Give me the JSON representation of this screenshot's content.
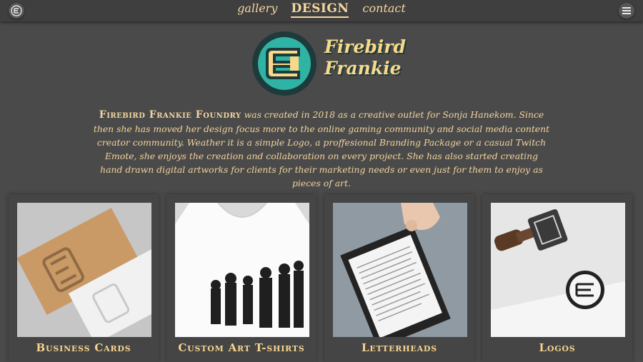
{
  "nav": {
    "items": [
      {
        "label": "gallery"
      },
      {
        "label": "DESIGN"
      },
      {
        "label": "contact"
      }
    ]
  },
  "brand": {
    "line1": "Firebird",
    "line2": "Frankie"
  },
  "description": {
    "lead": "Firebird Frankie Foundry",
    "body": " was created in 2018 as a creative outlet for Sonja Hanekom. Since then she has moved her design focus more to the online gaming community and social media content creator community. Weather it is a simple Logo, a proffesional Branding Package or a casual Twitch Emote, she enjoys the creation and collaboration on every project. She has also started creating hand drawn digital artworks for clients for their marketing needs or even just for them to enjoy as  pieces of art."
  },
  "cards": [
    {
      "title": "Business Cards"
    },
    {
      "title": "Custom Art T-shirts"
    },
    {
      "title": "Letterheads"
    },
    {
      "title": "Logos"
    }
  ],
  "colors": {
    "background": "#4a4a4a",
    "accent_text": "#f4d7a1",
    "logo_teal": "#2fb3a4",
    "logo_gold": "#f7d98a",
    "logo_dark": "#1e3a3a"
  }
}
